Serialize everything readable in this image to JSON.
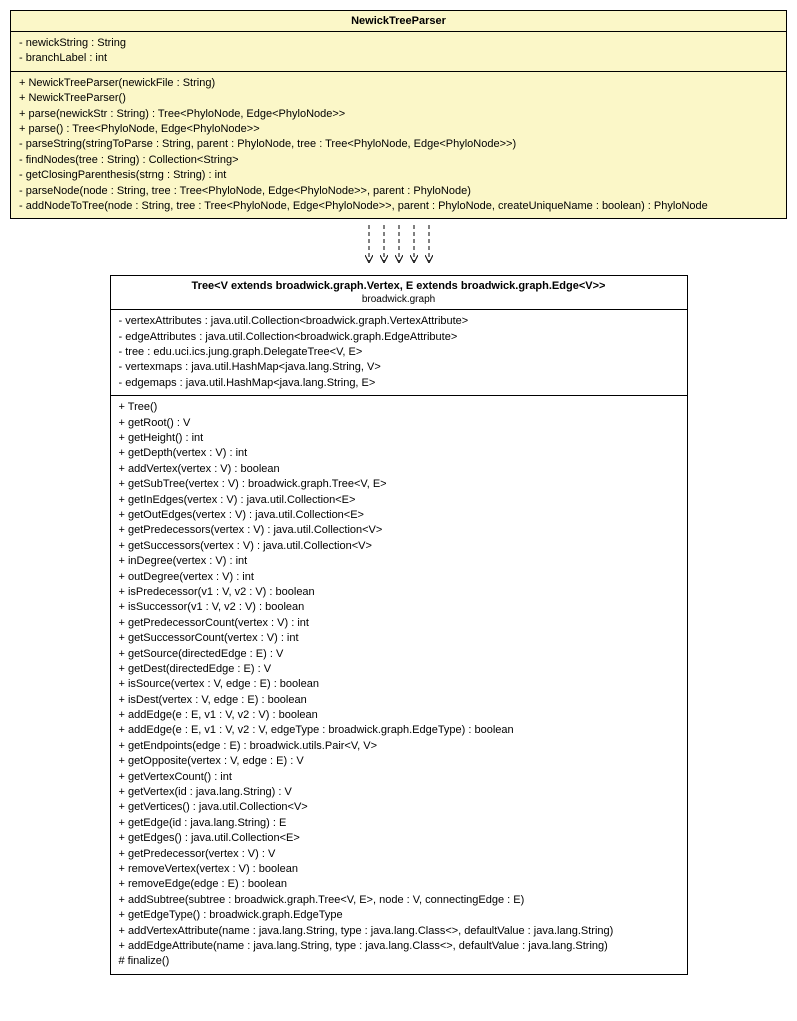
{
  "class1": {
    "name": "NewickTreeParser",
    "attrs": [
      "- newickString : String",
      "- branchLabel : int"
    ],
    "ops": [
      "+ NewickTreeParser(newickFile : String)",
      "+ NewickTreeParser()",
      "+ parse(newickStr : String) : Tree<PhyloNode, Edge<PhyloNode>>",
      "+ parse() : Tree<PhyloNode, Edge<PhyloNode>>",
      "- parseString(stringToParse : String, parent : PhyloNode, tree : Tree<PhyloNode, Edge<PhyloNode>>)",
      "- findNodes(tree : String) : Collection<String>",
      "- getClosingParenthesis(strng : String) : int",
      "- parseNode(node : String, tree : Tree<PhyloNode, Edge<PhyloNode>>, parent : PhyloNode)",
      "- addNodeToTree(node : String, tree : Tree<PhyloNode, Edge<PhyloNode>>, parent : PhyloNode, createUniqueName : boolean) : PhyloNode"
    ]
  },
  "class2": {
    "name": "Tree<V extends broadwick.graph.Vertex, E extends broadwick.graph.Edge<V>>",
    "pkg": "broadwick.graph",
    "attrs": [
      "- vertexAttributes : java.util.Collection<broadwick.graph.VertexAttribute>",
      "- edgeAttributes : java.util.Collection<broadwick.graph.EdgeAttribute>",
      "- tree : edu.uci.ics.jung.graph.DelegateTree<V, E>",
      "- vertexmaps : java.util.HashMap<java.lang.String, V>",
      "- edgemaps : java.util.HashMap<java.lang.String, E>"
    ],
    "ops": [
      "+ Tree()",
      "+ getRoot() : V",
      "+ getHeight() : int",
      "+ getDepth(vertex : V) : int",
      "+ addVertex(vertex : V) : boolean",
      "+ getSubTree(vertex : V) : broadwick.graph.Tree<V, E>",
      "+ getInEdges(vertex : V) : java.util.Collection<E>",
      "+ getOutEdges(vertex : V) : java.util.Collection<E>",
      "+ getPredecessors(vertex : V) : java.util.Collection<V>",
      "+ getSuccessors(vertex : V) : java.util.Collection<V>",
      "+ inDegree(vertex : V) : int",
      "+ outDegree(vertex : V) : int",
      "+ isPredecessor(v1 : V, v2 : V) : boolean",
      "+ isSuccessor(v1 : V, v2 : V) : boolean",
      "+ getPredecessorCount(vertex : V) : int",
      "+ getSuccessorCount(vertex : V) : int",
      "+ getSource(directedEdge : E) : V",
      "+ getDest(directedEdge : E) : V",
      "+ isSource(vertex : V, edge : E) : boolean",
      "+ isDest(vertex : V, edge : E) : boolean",
      "+ addEdge(e : E, v1 : V, v2 : V) : boolean",
      "+ addEdge(e : E, v1 : V, v2 : V, edgeType : broadwick.graph.EdgeType) : boolean",
      "+ getEndpoints(edge : E) : broadwick.utils.Pair<V, V>",
      "+ getOpposite(vertex : V, edge : E) : V",
      "+ getVertexCount() : int",
      "+ getVertex(id : java.lang.String) : V",
      "+ getVertices() : java.util.Collection<V>",
      "+ getEdge(id : java.lang.String) : E",
      "+ getEdges() : java.util.Collection<E>",
      "+ getPredecessor(vertex : V) : V",
      "+ removeVertex(vertex : V) : boolean",
      "+ removeEdge(edge : E) : boolean",
      "+ addSubtree(subtree : broadwick.graph.Tree<V, E>, node : V, connectingEdge : E)",
      "+ getEdgeType() : broadwick.graph.EdgeType",
      "+ addVertexAttribute(name : java.lang.String, type : java.lang.Class<>, defaultValue : java.lang.String)",
      "+ addEdgeAttribute(name : java.lang.String, type : java.lang.Class<>, defaultValue : java.lang.String)",
      "# finalize()"
    ]
  }
}
